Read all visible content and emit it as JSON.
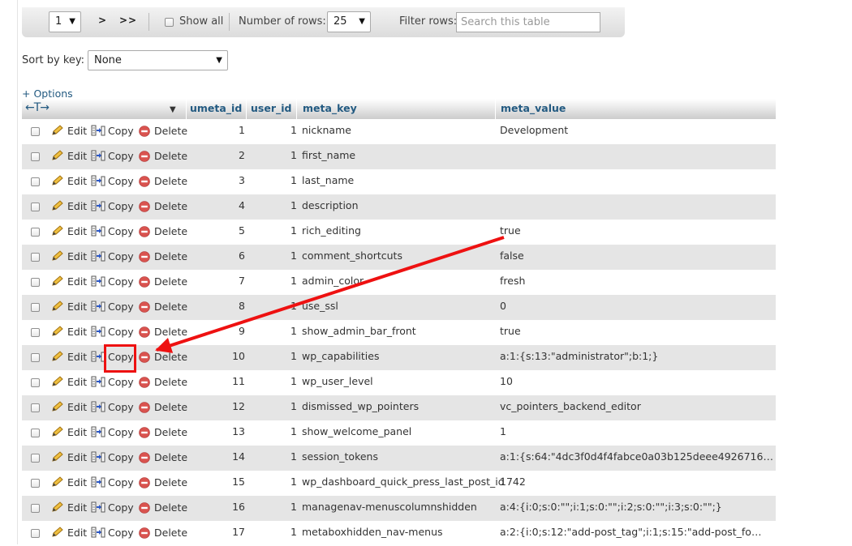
{
  "nav": {
    "page_value": "1",
    "next_label": ">",
    "last_label": ">>",
    "show_all_label": "Show all",
    "rows_label": "Number of rows:",
    "rows_value": "25",
    "filter_label": "Filter rows:",
    "filter_placeholder": "Search this table"
  },
  "sort": {
    "label": "Sort by key:",
    "value": "None"
  },
  "options_label": "+ Options",
  "columns": {
    "umeta_id": "umeta_id",
    "user_id": "user_id",
    "meta_key": "meta_key",
    "meta_value": "meta_value"
  },
  "actions": {
    "edit": "Edit",
    "copy": "Copy",
    "delete": "Delete"
  },
  "rows": [
    {
      "umeta_id": "1",
      "user_id": "1",
      "meta_key": "nickname",
      "meta_value": "Development"
    },
    {
      "umeta_id": "2",
      "user_id": "1",
      "meta_key": "first_name",
      "meta_value": ""
    },
    {
      "umeta_id": "3",
      "user_id": "1",
      "meta_key": "last_name",
      "meta_value": ""
    },
    {
      "umeta_id": "4",
      "user_id": "1",
      "meta_key": "description",
      "meta_value": ""
    },
    {
      "umeta_id": "5",
      "user_id": "1",
      "meta_key": "rich_editing",
      "meta_value": "true"
    },
    {
      "umeta_id": "6",
      "user_id": "1",
      "meta_key": "comment_shortcuts",
      "meta_value": "false"
    },
    {
      "umeta_id": "7",
      "user_id": "1",
      "meta_key": "admin_color",
      "meta_value": "fresh"
    },
    {
      "umeta_id": "8",
      "user_id": "1",
      "meta_key": "use_ssl",
      "meta_value": "0"
    },
    {
      "umeta_id": "9",
      "user_id": "1",
      "meta_key": "show_admin_bar_front",
      "meta_value": "true"
    },
    {
      "umeta_id": "10",
      "user_id": "1",
      "meta_key": "wp_capabilities",
      "meta_value": "a:1:{s:13:\"administrator\";b:1;}"
    },
    {
      "umeta_id": "11",
      "user_id": "1",
      "meta_key": "wp_user_level",
      "meta_value": "10"
    },
    {
      "umeta_id": "12",
      "user_id": "1",
      "meta_key": "dismissed_wp_pointers",
      "meta_value": "vc_pointers_backend_editor"
    },
    {
      "umeta_id": "13",
      "user_id": "1",
      "meta_key": "show_welcome_panel",
      "meta_value": "1"
    },
    {
      "umeta_id": "14",
      "user_id": "1",
      "meta_key": "session_tokens",
      "meta_value": "a:1:{s:64:\"4dc3f0d4f4fabce0a03b125deee4926716b42aa…"
    },
    {
      "umeta_id": "15",
      "user_id": "1",
      "meta_key": "wp_dashboard_quick_press_last_post_id",
      "meta_value": "1742"
    },
    {
      "umeta_id": "16",
      "user_id": "1",
      "meta_key": "managenav-menuscolumnshidden",
      "meta_value": "a:4:{i:0;s:0:\"\";i:1;s:0:\"\";i:2;s:0:\"\";i:3;s:0:\"\";}"
    },
    {
      "umeta_id": "17",
      "user_id": "1",
      "meta_key": "metaboxhidden_nav-menus",
      "meta_value": "a:2:{i:0;s:12:\"add-post_tag\";i:1;s:15:\"add-post_fo…"
    }
  ],
  "annotation": {
    "color": "#ee1111",
    "highlighted_row_umeta_id": "10",
    "highlighted_action": "Copy"
  },
  "colors": {
    "link": "#235a81",
    "row_alt": "#e5e5e5",
    "delete_icon": "#d9534f"
  }
}
